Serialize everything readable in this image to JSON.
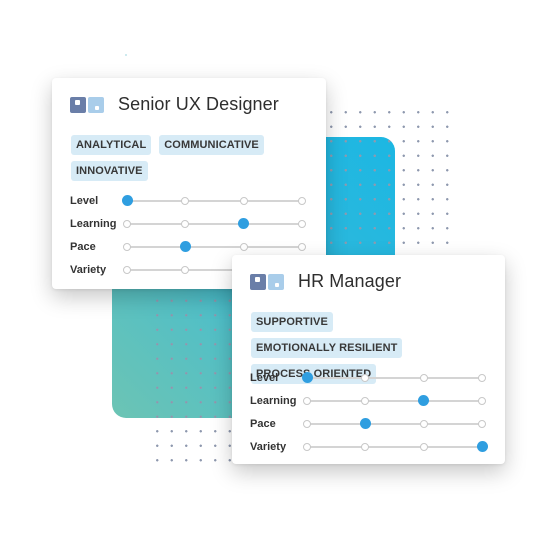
{
  "decor": {
    "accent_gradient": [
      "#1cb7e3",
      "#6cc4b4"
    ],
    "tag_background": "#d7ebf6",
    "knob_color": "#2f9ee0"
  },
  "cards": [
    {
      "title": "Senior UX Designer",
      "icon": "role-card-icon",
      "tags": [
        "ANALYTICAL",
        "COMMUNICATIVE",
        "INNOVATIVE"
      ],
      "sliders": [
        {
          "label": "Level",
          "steps": 4,
          "value": 1
        },
        {
          "label": "Learning",
          "steps": 4,
          "value": 3
        },
        {
          "label": "Pace",
          "steps": 4,
          "value": 2
        },
        {
          "label": "Variety",
          "steps": 4,
          "value": null
        }
      ]
    },
    {
      "title": "HR Manager",
      "icon": "role-card-icon",
      "tags": [
        "SUPPORTIVE",
        "EMOTIONALLY RESILIENT",
        "PROCESS ORIENTED"
      ],
      "sliders": [
        {
          "label": "Level",
          "steps": 4,
          "value": 1
        },
        {
          "label": "Learning",
          "steps": 4,
          "value": 3
        },
        {
          "label": "Pace",
          "steps": 4,
          "value": 2
        },
        {
          "label": "Variety",
          "steps": 4,
          "value": 4
        }
      ]
    }
  ]
}
